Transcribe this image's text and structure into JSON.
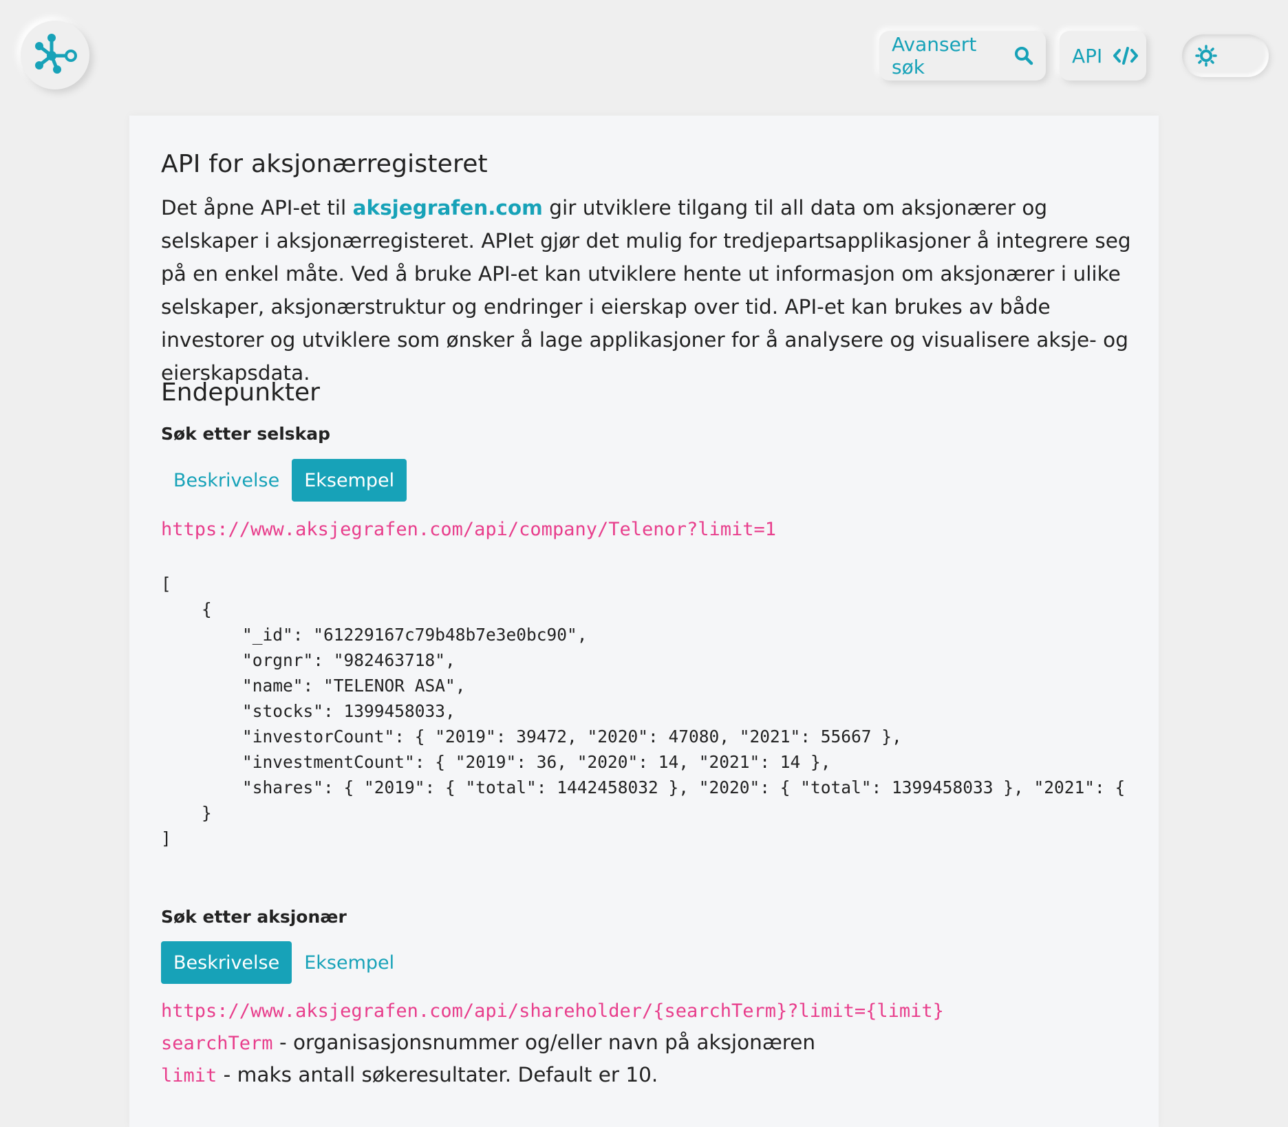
{
  "header": {
    "logo_icon": "network-graph-icon",
    "advanced_search_label": "Avansert søk",
    "advanced_search_icon": "search-icon",
    "api_label": "API",
    "api_icon": "code-icon",
    "theme_icon": "sun-icon"
  },
  "colors": {
    "accent": "#17a2b8",
    "code": "#e83e8c",
    "background": "#efefef"
  },
  "main": {
    "title": "API for aksjonærregisteret",
    "intro_before": "Det åpne API-et til ",
    "intro_link": "aksjegrafen.com",
    "intro_after": " gir utviklere tilgang til all data om aksjonærer og selskaper i aksjonærregisteret. APIet gjør det mulig for tredjepartsapplikasjoner å integrere seg på en enkel måte. Ved å bruke API-et kan utviklere hente ut informasjon om aksjonærer i ulike selskaper, aksjonærstruktur og endringer i eierskap over tid. API-et kan brukes av både investorer og utviklere som ønsker å lage applikasjoner for å analysere og visualisere aksje- og eierskapsdata.",
    "endpoints_title": "Endepunkter"
  },
  "endpoints": [
    {
      "title": "Søk etter selskap",
      "tabs": [
        "Beskrivelse",
        "Eksempel"
      ],
      "active_tab": "Eksempel",
      "url": "https://www.aksjegrafen.com/api/company/Telenor?limit=1",
      "example_response": "[\n    {\n        \"_id\": \"61229167c79b48b7e3e0bc90\",\n        \"orgnr\": \"982463718\",\n        \"name\": \"TELENOR ASA\",\n        \"stocks\": 1399458033,\n        \"investorCount\": { \"2019\": 39472, \"2020\": 47080, \"2021\": 55667 },\n        \"investmentCount\": { \"2019\": 36, \"2020\": 14, \"2021\": 14 },\n        \"shares\": { \"2019\": { \"total\": 1442458032 }, \"2020\": { \"total\": 1399458033 }, \"2021\": {\n    }\n]"
    },
    {
      "title": "Søk etter aksjonær",
      "tabs": [
        "Beskrivelse",
        "Eksempel"
      ],
      "active_tab": "Beskrivelse",
      "url": "https://www.aksjegrafen.com/api/shareholder/{searchTerm}?limit={limit}",
      "params": [
        {
          "name": "searchTerm",
          "description": " - organisasjonsnummer og/eller navn på aksjonæren"
        },
        {
          "name": "limit",
          "description": " - maks antall søkeresultater. Default er 10."
        }
      ]
    }
  ]
}
